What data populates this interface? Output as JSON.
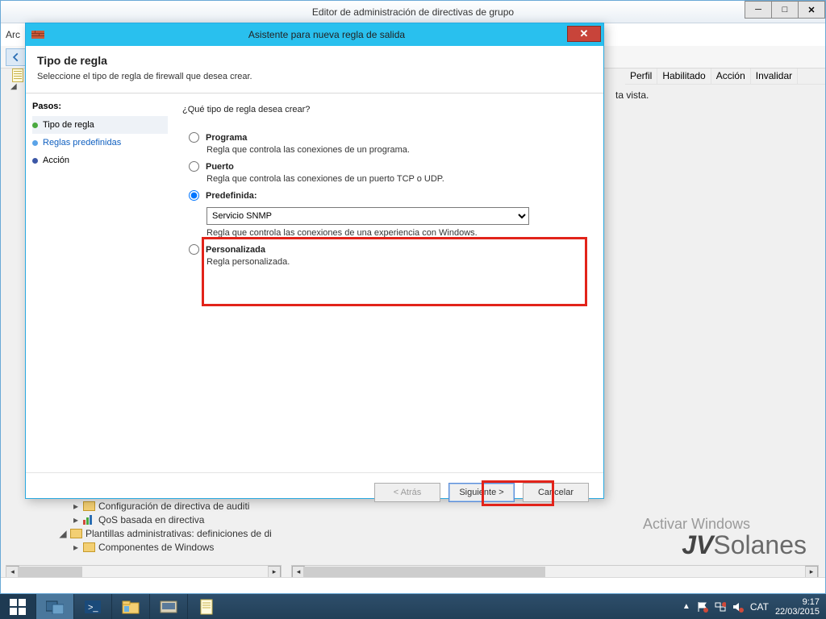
{
  "parent": {
    "title": "Editor de administración de directivas de grupo",
    "menu_file": "Arc",
    "right_headers": [
      "Perfil",
      "Habilitado",
      "Acción",
      "Invalidar"
    ],
    "right_hint": "ta vista."
  },
  "tree": {
    "row1": "Configuración de directiva de auditi",
    "row2": "QoS basada en directiva",
    "row3": "Plantillas administrativas: definiciones de di",
    "row4": "Componentes de Windows"
  },
  "wizard": {
    "title": "Asistente para nueva regla de salida",
    "heading": "Tipo de regla",
    "subheading": "Seleccione el tipo de regla de firewall que desea crear.",
    "steps_label": "Pasos:",
    "steps": {
      "s1": "Tipo de regla",
      "s2": "Reglas predefinidas",
      "s3": "Acción"
    },
    "question": "¿Qué tipo de regla desea crear?",
    "opt_program": {
      "label": "Programa",
      "desc": "Regla que controla las conexiones de un programa."
    },
    "opt_port": {
      "label": "Puerto",
      "desc": "Regla que controla las conexiones de un puerto TCP o UDP."
    },
    "opt_predef": {
      "label": "Predefinida:",
      "desc": "Regla que controla las conexiones de una experiencia con Windows.",
      "selected": "Servicio SNMP"
    },
    "opt_custom": {
      "label": "Personalizada",
      "desc": "Regla personalizada."
    },
    "buttons": {
      "back": "< Atrás",
      "next": "Siguiente >",
      "cancel": "Cancelar"
    }
  },
  "watermark": {
    "line1": "Activar Windows",
    "brand_prefix": "JV",
    "brand_rest": "Solanes"
  },
  "tray": {
    "lang": "CAT",
    "time": "9:17",
    "date": "22/03/2015"
  }
}
